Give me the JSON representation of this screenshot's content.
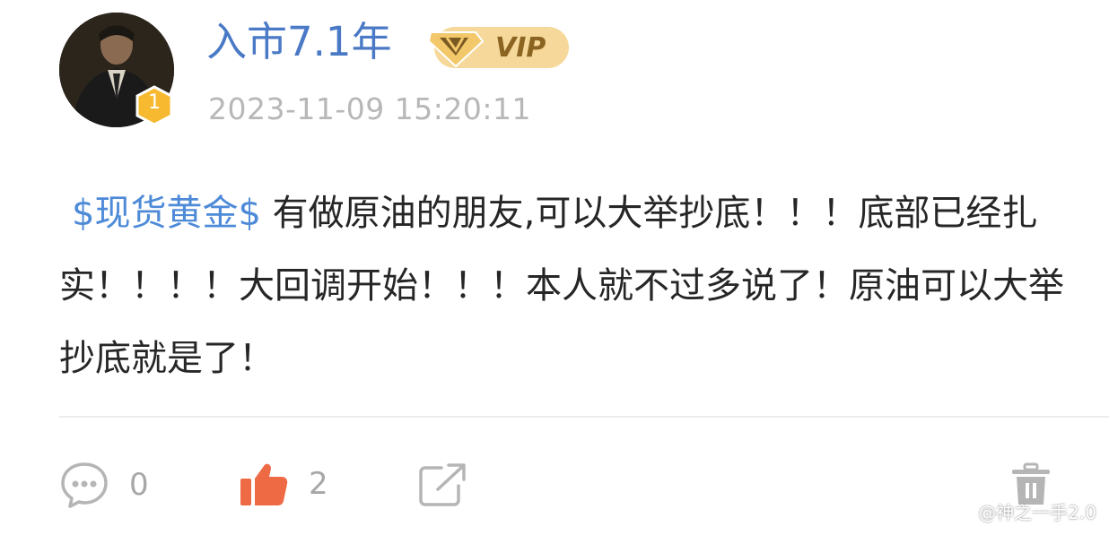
{
  "user": {
    "name": "入市7.1年",
    "vip_label": "VIP",
    "level": "1",
    "timestamp": "2023-11-09 15:20:11"
  },
  "post": {
    "tag": "$现货黄金$",
    "text": " 有做原油的朋友,可以大举抄底！！！底部已经扎实！！！！大回调开始！！！本人就不过多说了！原油可以大举抄底就是了！"
  },
  "actions": {
    "comment_count": "0",
    "like_count": "2"
  },
  "watermark": "@神之一手2.0",
  "colors": {
    "username": "#4a79c5",
    "tag": "#4d8ad8",
    "like_icon": "#ee6a45",
    "level_badge": "#f6b92f",
    "vip_gold": "#f3cd7a"
  }
}
